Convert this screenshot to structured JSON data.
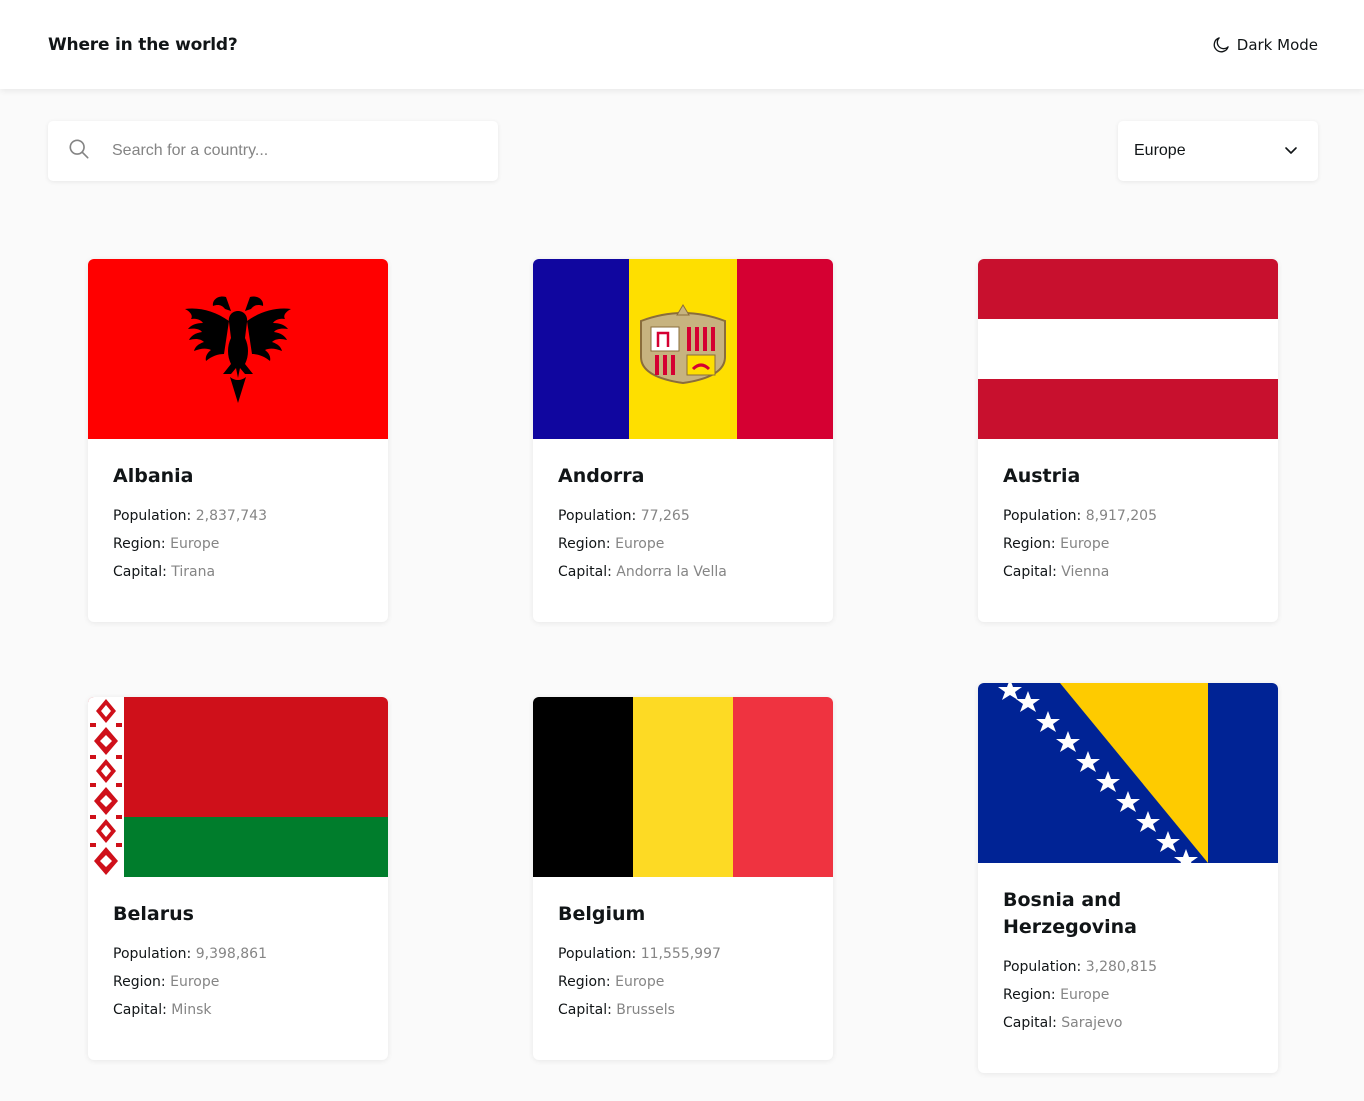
{
  "header": {
    "title": "Where in the world?",
    "theme_toggle_label": "Dark Mode",
    "theme_toggle_icon": "moon-icon"
  },
  "search": {
    "placeholder": "Search for a country...",
    "value": "",
    "icon": "search-icon"
  },
  "filter": {
    "selected": "Europe",
    "icon": "chevron-down-icon"
  },
  "labels": {
    "population": "Population:",
    "region": "Region:",
    "capital": "Capital:"
  },
  "countries": [
    {
      "name": "Albania",
      "population": "2,837,743",
      "region": "Europe",
      "capital": "Tirana",
      "flag": "albania-flag",
      "flag_colors": [
        "#ff0000",
        "#000000"
      ]
    },
    {
      "name": "Andorra",
      "population": "77,265",
      "region": "Europe",
      "capital": "Andorra la Vella",
      "flag": "andorra-flag",
      "flag_colors": [
        "#10069f",
        "#fedf00",
        "#d50032"
      ]
    },
    {
      "name": "Austria",
      "population": "8,917,205",
      "region": "Europe",
      "capital": "Vienna",
      "flag": "austria-flag",
      "flag_colors": [
        "#c8102e",
        "#ffffff"
      ]
    },
    {
      "name": "Belarus",
      "population": "9,398,861",
      "region": "Europe",
      "capital": "Minsk",
      "flag": "belarus-flag",
      "flag_colors": [
        "#cf101a",
        "#007d2c",
        "#ffffff"
      ]
    },
    {
      "name": "Belgium",
      "population": "11,555,997",
      "region": "Europe",
      "capital": "Brussels",
      "flag": "belgium-flag",
      "flag_colors": [
        "#000000",
        "#fdda24",
        "#ef3340"
      ]
    },
    {
      "name": "Bosnia and Herzegovina",
      "population": "3,280,815",
      "region": "Europe",
      "capital": "Sarajevo",
      "flag": "bosnia-flag",
      "flag_colors": [
        "#002395",
        "#fecb00",
        "#ffffff"
      ]
    }
  ]
}
